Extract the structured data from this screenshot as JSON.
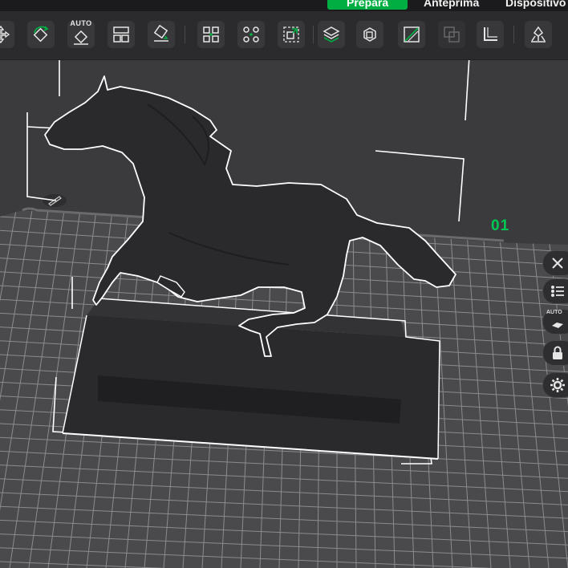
{
  "tabs": [
    {
      "label": "Prepara",
      "active": true
    },
    {
      "label": "Anteprima",
      "active": false
    },
    {
      "label": "Dispositivo",
      "active": false
    }
  ],
  "toolbar": {
    "auto_label": "AUTO",
    "buttons": [
      "move-icon",
      "rotate-icon",
      "auto-orient-icon",
      "arrange-icon",
      "lay-on-face-icon",
      "split-to-objects-icon",
      "split-to-parts-icon",
      "fit-to-plate-icon",
      "layer-editing-icon",
      "cube-icon",
      "cut-icon",
      "boolean-icon",
      "measure-icon",
      "paint-supports-icon"
    ]
  },
  "plate": {
    "number": "01",
    "edit_icon": "pencil-icon"
  },
  "side_toolbar": {
    "auto_label": "AUTO",
    "buttons": [
      "close-icon",
      "list-icon",
      "auto-arrange-icon",
      "lock-icon",
      "settings-icon"
    ]
  },
  "colors": {
    "accent": "#00ae42",
    "plate_number": "#00c853",
    "viewport_bg": "#3b3b3e",
    "grid_line": "#8a8a8d",
    "model": "#2b2b2d",
    "selection_outline": "#ffffff"
  }
}
